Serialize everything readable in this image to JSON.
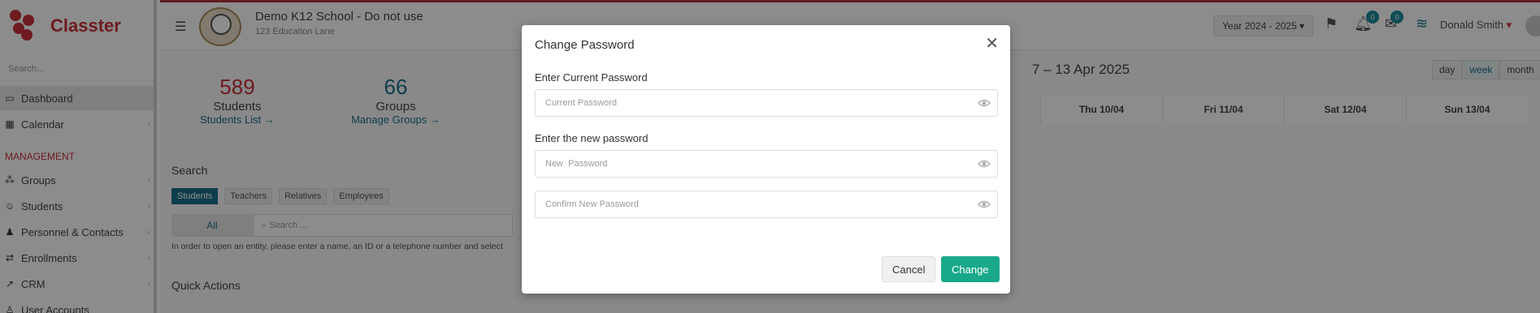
{
  "app": {
    "name": "Classter"
  },
  "sidebar": {
    "search_placeholder": "Search...",
    "items": [
      {
        "label": "Dashboard",
        "icon": "laptop-icon"
      },
      {
        "label": "Calendar",
        "icon": "calendar-icon"
      }
    ],
    "section_label": "MANAGEMENT",
    "management_items": [
      {
        "label": "Groups",
        "icon": "groups-icon"
      },
      {
        "label": "Students",
        "icon": "students-icon"
      },
      {
        "label": "Personnel & Contacts",
        "icon": "person-icon"
      },
      {
        "label": "Enrollments",
        "icon": "arrows-icon"
      },
      {
        "label": "CRM",
        "icon": "chart-icon"
      },
      {
        "label": "User Accounts",
        "icon": "user-icon"
      }
    ]
  },
  "header": {
    "school_name": "Demo K12 School - Do not use",
    "school_address": "123 Education Lane",
    "year": "Year 2024 - 2025",
    "notifications_count": "0",
    "messages_count": "0",
    "user_name": "Donald Smith"
  },
  "stats": [
    {
      "value": "589",
      "label": "Students",
      "link": "Students List"
    },
    {
      "value": "66",
      "label": "Groups",
      "link": "Manage Groups"
    }
  ],
  "search": {
    "title": "Search",
    "tabs": [
      "Students",
      "Teachers",
      "Relatives",
      "Employees"
    ],
    "all_label": "All",
    "placeholder": "Search ...",
    "hint": "In order to open an entity, please enter a name, an ID or a telephone number and select"
  },
  "quick_actions": {
    "title": "Quick Actions"
  },
  "calendar": {
    "range": "7 – 13 Apr 2025",
    "views": [
      "day",
      "week",
      "month"
    ],
    "days": [
      "Thu 10/04",
      "Fri 11/04",
      "Sat 12/04",
      "Sun 13/04"
    ]
  },
  "modal": {
    "title": "Change Password",
    "current_label": "Enter Current Password",
    "current_placeholder": "Current Password",
    "new_label": "Enter the new password",
    "new_placeholder": "New  Password",
    "confirm_placeholder": "Confirm New Password",
    "cancel_label": "Cancel",
    "change_label": "Change"
  },
  "colors": {
    "brand": "#c8323a",
    "primary": "#1aa88a",
    "accent": "#1a6f8a"
  }
}
